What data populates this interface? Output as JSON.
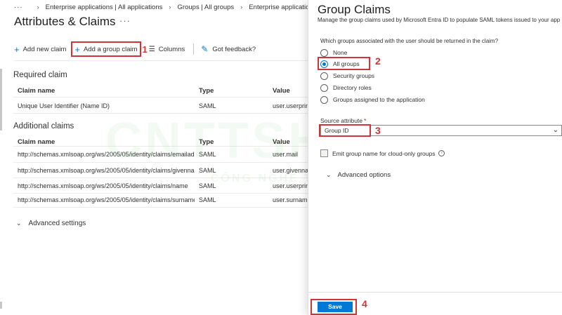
{
  "breadcrumb": {
    "more": "···",
    "items": [
      "Enterprise applications | All applications",
      "Groups | All groups",
      "Enterprise applications | All appl"
    ]
  },
  "page": {
    "title": "Attributes & Claims",
    "title_more": "···"
  },
  "toolbar": {
    "add_new_claim": "Add new claim",
    "add_group_claim": "Add a group claim",
    "columns": "Columns",
    "feedback": "Got feedback?"
  },
  "required": {
    "title": "Required claim",
    "headers": [
      "Claim name",
      "Type",
      "Value"
    ],
    "rows": [
      [
        "Unique User Identifier (Name ID)",
        "SAML",
        "user.userprinc"
      ]
    ]
  },
  "additional": {
    "title": "Additional claims",
    "headers": [
      "Claim name",
      "Type",
      "Value"
    ],
    "rows": [
      [
        "http://schemas.xmlsoap.org/ws/2005/05/identity/claims/emailadd...",
        "SAML",
        "user.mail"
      ],
      [
        "http://schemas.xmlsoap.org/ws/2005/05/identity/claims/givenname",
        "SAML",
        "user.givennar"
      ],
      [
        "http://schemas.xmlsoap.org/ws/2005/05/identity/claims/name",
        "SAML",
        "user.userprinc"
      ],
      [
        "http://schemas.xmlsoap.org/ws/2005/05/identity/claims/surname",
        "SAML",
        "user.surname"
      ]
    ]
  },
  "advanced_settings": "Advanced settings",
  "watermark": {
    "main": "CNTTSHOP.VN",
    "sub": "CÔNG NGHỆ THÂN THIỆN"
  },
  "panel": {
    "title": "Group Claims",
    "subtitle": "Manage the group claims used by Microsoft Entra ID to populate SAML tokens issued to your app",
    "question": "Which groups associated with the user should be returned in the claim?",
    "options": [
      "None",
      "All groups",
      "Security groups",
      "Directory roles",
      "Groups assigned to the application"
    ],
    "selected_option": "All groups",
    "source_attribute_label": "Source attribute",
    "required_mark": "*",
    "source_attribute_value": "Group ID",
    "emit_checkbox": "Emit group name for cloud-only groups",
    "advanced_options": "Advanced options",
    "save": "Save"
  },
  "markers": [
    "1",
    "2",
    "3",
    "4"
  ],
  "colors": {
    "accent": "#0078d4",
    "highlight": "#d13438"
  }
}
